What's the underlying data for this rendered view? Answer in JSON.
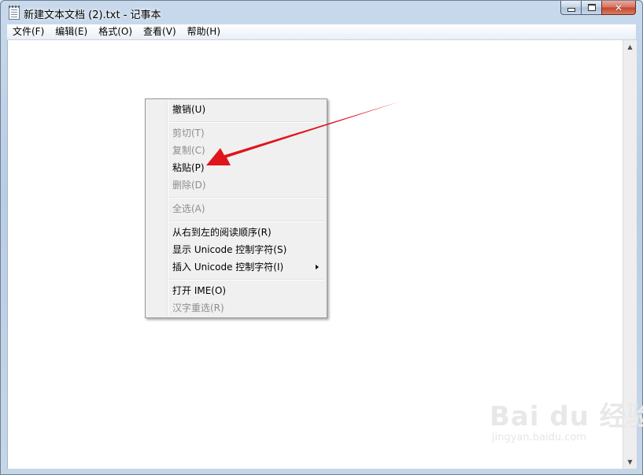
{
  "window": {
    "title": "新建文本文档 (2).txt - 记事本",
    "close_glyph": "✕"
  },
  "menubar": {
    "items": [
      "文件(F)",
      "编辑(E)",
      "格式(O)",
      "查看(V)",
      "帮助(H)"
    ]
  },
  "scrollbar": {
    "up": "▲",
    "down": "▼"
  },
  "context_menu": {
    "items": [
      {
        "label": "撤销(U)",
        "enabled": true
      },
      {
        "label": "剪切(T)",
        "enabled": false
      },
      {
        "label": "复制(C)",
        "enabled": false
      },
      {
        "label": "粘贴(P)",
        "enabled": true
      },
      {
        "label": "删除(D)",
        "enabled": false
      },
      {
        "label": "全选(A)",
        "enabled": false
      },
      {
        "label": "从右到左的阅读顺序(R)",
        "enabled": true
      },
      {
        "label": "显示 Unicode 控制字符(S)",
        "enabled": true
      },
      {
        "label": "插入 Unicode 控制字符(I)",
        "enabled": true,
        "submenu": true
      },
      {
        "label": "打开 IME(O)",
        "enabled": true
      },
      {
        "label": "汉字重选(R)",
        "enabled": false
      }
    ]
  },
  "annotation": {
    "color": "#e0141c"
  },
  "watermark": {
    "logo": "Bai du 经验",
    "url": "jingyan.baidu.com"
  }
}
